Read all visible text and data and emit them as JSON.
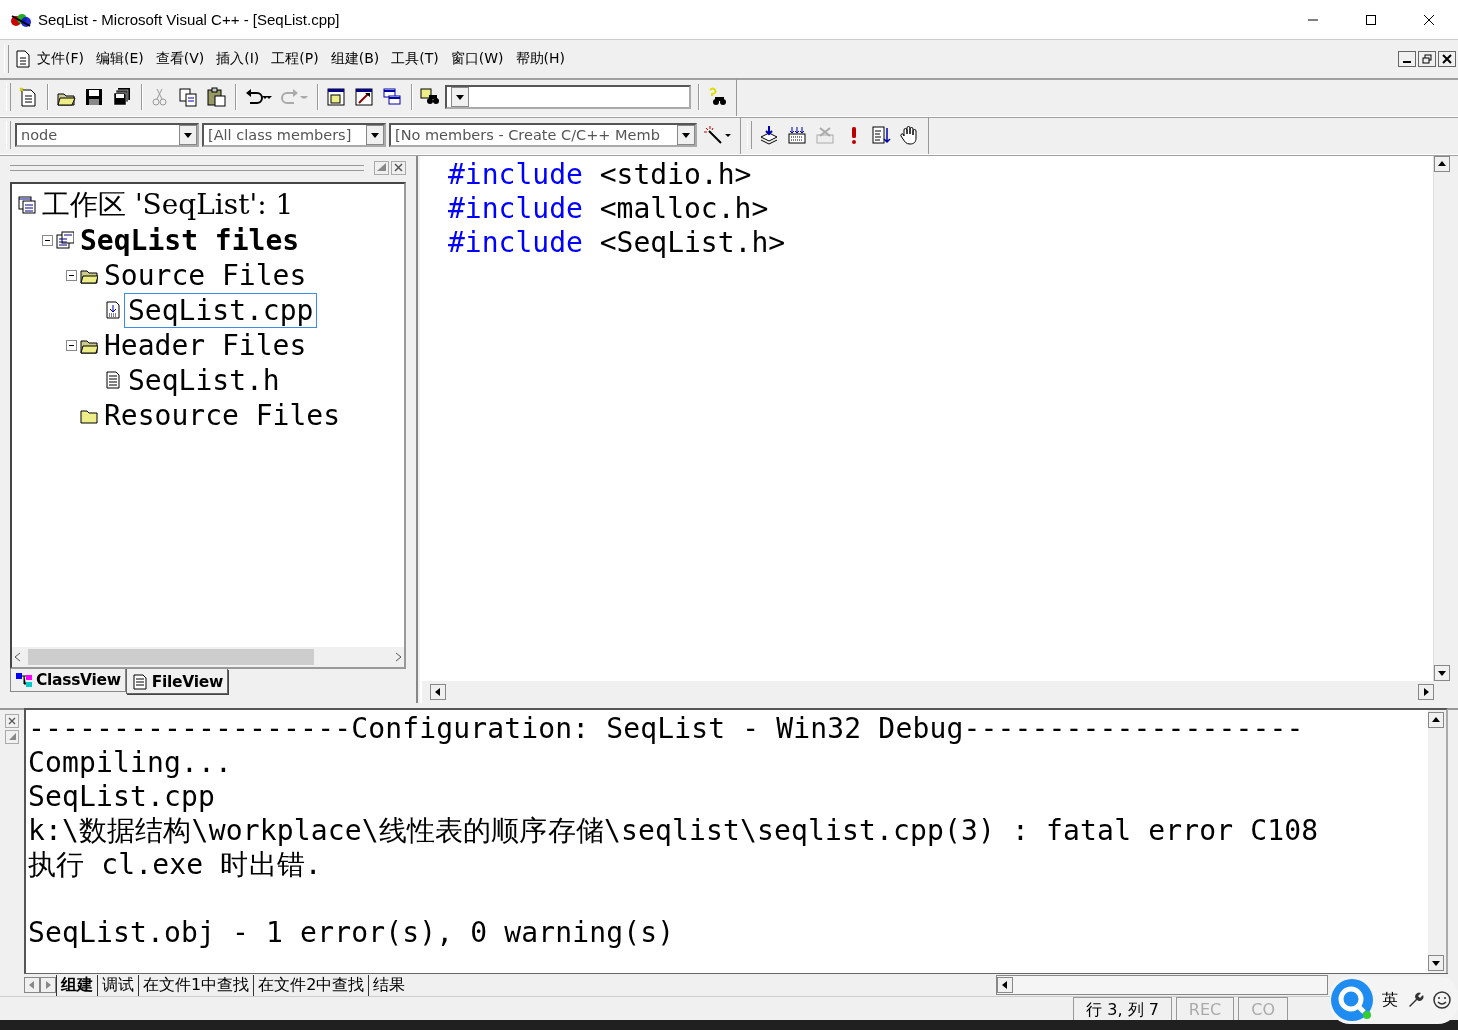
{
  "title_bar": {
    "title": "SeqList - Microsoft Visual C++ - [SeqList.cpp]"
  },
  "menu": [
    "文件(F)",
    "编辑(E)",
    "查看(V)",
    "插入(I)",
    "工程(P)",
    "组建(B)",
    "工具(T)",
    "窗口(W)",
    "帮助(H)"
  ],
  "wizard_bar": {
    "class_combo": "node",
    "filter_combo": "[All class members]",
    "members_combo": "[No members - Create C/C++ Memb"
  },
  "workspace": {
    "tree": [
      {
        "label": "工作区 'SeqList': 1",
        "kind": "workspace",
        "children": [
          {
            "label": "SeqList files",
            "kind": "project",
            "expanded": true,
            "children": [
              {
                "label": "Source Files",
                "kind": "folder",
                "expanded": true,
                "children": [
                  {
                    "label": "SeqList.cpp",
                    "kind": "source",
                    "selected": true
                  }
                ]
              },
              {
                "label": "Header Files",
                "kind": "folder",
                "expanded": true,
                "children": [
                  {
                    "label": "SeqList.h",
                    "kind": "header",
                    "selected": false
                  }
                ]
              },
              {
                "label": "Resource Files",
                "kind": "folder"
              }
            ]
          }
        ]
      }
    ],
    "tabs": [
      {
        "label": "ClassView",
        "kind": "class",
        "selected": false
      },
      {
        "label": "FileView",
        "kind": "file",
        "selected": true
      }
    ]
  },
  "editor": {
    "lines": [
      {
        "directive": "#include",
        "argument": "<stdio.h>"
      },
      {
        "directive": "#include",
        "argument": "<malloc.h>"
      },
      {
        "directive": "#include",
        "argument": "<SeqList.h>"
      }
    ]
  },
  "output": {
    "lines": [
      {
        "text": "-------------------Configuration: SeqList - Win32 Debug--------------------"
      },
      {
        "text": "Compiling..."
      },
      {
        "text": "SeqList.cpp"
      },
      {
        "text": "k:\\数据结构\\workplace\\线性表的顺序存储\\seqlist\\seqlist.cpp(3) : fatal error C108"
      },
      {
        "text": "执行 cl.exe 时出错."
      },
      {
        "kind": "blank"
      },
      {
        "text": "SeqList.obj - 1 error(s), 0 warning(s)"
      }
    ],
    "tabs": [
      {
        "label": "组建",
        "selected": true
      },
      {
        "label": "调试",
        "selected": false
      },
      {
        "label": "在文件1中查找",
        "selected": false
      },
      {
        "label": "在文件2中查找",
        "selected": false
      },
      {
        "label": "结果",
        "selected": false
      }
    ]
  },
  "status_bar": {
    "position": "行 3, 列 7",
    "indicators": [
      "REC",
      "CO"
    ]
  },
  "ime": {
    "language": "英"
  }
}
